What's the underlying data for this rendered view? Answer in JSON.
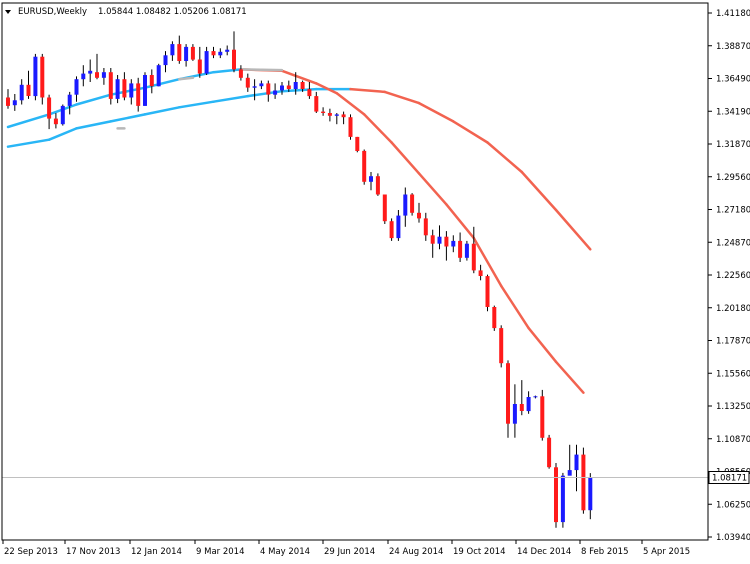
{
  "chart_data": {
    "type": "candlestick",
    "symbol": "EURUSD",
    "timeframe": "Weekly",
    "title": "EURUSD,Weekly",
    "ohlc_text": "1.05844 1.08482 1.05206 1.08171",
    "last_price": 1.08171,
    "last_price_label": "1.08171",
    "ylim": [
      1.0394,
      1.4121
    ],
    "yticks": [
      "1.41180",
      "1.38870",
      "1.36490",
      "1.34190",
      "1.31870",
      "1.29560",
      "1.27180",
      "1.24870",
      "1.22560",
      "1.20180",
      "1.17870",
      "1.15560",
      "1.13250",
      "1.10870",
      "1.08560",
      "1.06250",
      "1.03940"
    ],
    "xticks": [
      "22 Sep 2013",
      "17 Nov 2013",
      "12 Jan 2014",
      "9 Mar 2014",
      "4 May 2014",
      "29 Jun 2014",
      "24 Aug 2014",
      "19 Oct 2014",
      "14 Dec 2014",
      "8 Feb 2015",
      "5 Apr 2015"
    ],
    "grid": false,
    "colors": {
      "bull": "#1a1aff",
      "bear": "#ff1a1a",
      "wick": "#000000",
      "ma_fast_up": "#29b6f6",
      "ma_fast_down": "#f26350",
      "ma_flat": "#b8b8b8",
      "axis": "#000000",
      "price_line": "#c0c0c0"
    },
    "candles": [
      {
        "o": 1.352,
        "h": 1.358,
        "l": 1.344,
        "c": 1.346
      },
      {
        "o": 1.3465,
        "h": 1.3545,
        "l": 1.3425,
        "c": 1.35
      },
      {
        "o": 1.35,
        "h": 1.365,
        "l": 1.347,
        "c": 1.361
      },
      {
        "o": 1.361,
        "h": 1.371,
        "l": 1.351,
        "c": 1.353
      },
      {
        "o": 1.353,
        "h": 1.383,
        "l": 1.35,
        "c": 1.381
      },
      {
        "o": 1.381,
        "h": 1.383,
        "l": 1.347,
        "c": 1.352
      },
      {
        "o": 1.352,
        "h": 1.354,
        "l": 1.3295,
        "c": 1.337
      },
      {
        "o": 1.337,
        "h": 1.341,
        "l": 1.33,
        "c": 1.333
      },
      {
        "o": 1.333,
        "h": 1.347,
        "l": 1.332,
        "c": 1.346
      },
      {
        "o": 1.346,
        "h": 1.356,
        "l": 1.34,
        "c": 1.354
      },
      {
        "o": 1.354,
        "h": 1.367,
        "l": 1.349,
        "c": 1.365
      },
      {
        "o": 1.365,
        "h": 1.375,
        "l": 1.36,
        "c": 1.369
      },
      {
        "o": 1.369,
        "h": 1.379,
        "l": 1.363,
        "c": 1.371
      },
      {
        "o": 1.37,
        "h": 1.383,
        "l": 1.365,
        "c": 1.366
      },
      {
        "o": 1.366,
        "h": 1.373,
        "l": 1.361,
        "c": 1.37
      },
      {
        "o": 1.37,
        "h": 1.373,
        "l": 1.347,
        "c": 1.351
      },
      {
        "o": 1.351,
        "h": 1.368,
        "l": 1.348,
        "c": 1.365
      },
      {
        "o": 1.365,
        "h": 1.37,
        "l": 1.35,
        "c": 1.352
      },
      {
        "o": 1.352,
        "h": 1.365,
        "l": 1.347,
        "c": 1.362
      },
      {
        "o": 1.362,
        "h": 1.366,
        "l": 1.342,
        "c": 1.346
      },
      {
        "o": 1.346,
        "h": 1.37,
        "l": 1.346,
        "c": 1.368
      },
      {
        "o": 1.368,
        "h": 1.372,
        "l": 1.355,
        "c": 1.36
      },
      {
        "o": 1.36,
        "h": 1.376,
        "l": 1.36,
        "c": 1.375
      },
      {
        "o": 1.375,
        "h": 1.385,
        "l": 1.37,
        "c": 1.382
      },
      {
        "o": 1.382,
        "h": 1.392,
        "l": 1.378,
        "c": 1.39
      },
      {
        "o": 1.39,
        "h": 1.396,
        "l": 1.376,
        "c": 1.378
      },
      {
        "o": 1.378,
        "h": 1.39,
        "l": 1.374,
        "c": 1.388
      },
      {
        "o": 1.388,
        "h": 1.39,
        "l": 1.378,
        "c": 1.379
      },
      {
        "o": 1.379,
        "h": 1.388,
        "l": 1.366,
        "c": 1.369
      },
      {
        "o": 1.369,
        "h": 1.388,
        "l": 1.368,
        "c": 1.385
      },
      {
        "o": 1.385,
        "h": 1.388,
        "l": 1.38,
        "c": 1.382
      },
      {
        "o": 1.382,
        "h": 1.387,
        "l": 1.38,
        "c": 1.3845
      },
      {
        "o": 1.3845,
        "h": 1.389,
        "l": 1.382,
        "c": 1.386
      },
      {
        "o": 1.386,
        "h": 1.399,
        "l": 1.37,
        "c": 1.372
      },
      {
        "o": 1.372,
        "h": 1.375,
        "l": 1.364,
        "c": 1.366
      },
      {
        "o": 1.366,
        "h": 1.369,
        "l": 1.356,
        "c": 1.359
      },
      {
        "o": 1.359,
        "h": 1.365,
        "l": 1.35,
        "c": 1.36
      },
      {
        "o": 1.36,
        "h": 1.364,
        "l": 1.358,
        "c": 1.362
      },
      {
        "o": 1.362,
        "h": 1.364,
        "l": 1.349,
        "c": 1.354
      },
      {
        "o": 1.354,
        "h": 1.362,
        "l": 1.351,
        "c": 1.357
      },
      {
        "o": 1.357,
        "h": 1.363,
        "l": 1.354,
        "c": 1.3605
      },
      {
        "o": 1.3605,
        "h": 1.364,
        "l": 1.356,
        "c": 1.358
      },
      {
        "o": 1.358,
        "h": 1.37,
        "l": 1.354,
        "c": 1.363
      },
      {
        "o": 1.363,
        "h": 1.364,
        "l": 1.356,
        "c": 1.358
      },
      {
        "o": 1.358,
        "h": 1.363,
        "l": 1.351,
        "c": 1.353
      },
      {
        "o": 1.353,
        "h": 1.356,
        "l": 1.341,
        "c": 1.342
      },
      {
        "o": 1.342,
        "h": 1.345,
        "l": 1.339,
        "c": 1.341
      },
      {
        "o": 1.341,
        "h": 1.344,
        "l": 1.335,
        "c": 1.339
      },
      {
        "o": 1.339,
        "h": 1.341,
        "l": 1.333,
        "c": 1.34
      },
      {
        "o": 1.34,
        "h": 1.342,
        "l": 1.333,
        "c": 1.338
      },
      {
        "o": 1.338,
        "h": 1.34,
        "l": 1.322,
        "c": 1.324
      },
      {
        "o": 1.324,
        "h": 1.324,
        "l": 1.313,
        "c": 1.314
      },
      {
        "o": 1.314,
        "h": 1.315,
        "l": 1.29,
        "c": 1.292
      },
      {
        "o": 1.292,
        "h": 1.299,
        "l": 1.286,
        "c": 1.296
      },
      {
        "o": 1.296,
        "h": 1.298,
        "l": 1.282,
        "c": 1.283
      },
      {
        "o": 1.283,
        "h": 1.283,
        "l": 1.262,
        "c": 1.264
      },
      {
        "o": 1.264,
        "h": 1.266,
        "l": 1.25,
        "c": 1.252
      },
      {
        "o": 1.252,
        "h": 1.272,
        "l": 1.25,
        "c": 1.268
      },
      {
        "o": 1.268,
        "h": 1.288,
        "l": 1.26,
        "c": 1.283
      },
      {
        "o": 1.283,
        "h": 1.284,
        "l": 1.268,
        "c": 1.27
      },
      {
        "o": 1.27,
        "h": 1.277,
        "l": 1.263,
        "c": 1.266
      },
      {
        "o": 1.266,
        "h": 1.27,
        "l": 1.25,
        "c": 1.254
      },
      {
        "o": 1.254,
        "h": 1.258,
        "l": 1.238,
        "c": 1.248
      },
      {
        "o": 1.248,
        "h": 1.261,
        "l": 1.244,
        "c": 1.253
      },
      {
        "o": 1.253,
        "h": 1.257,
        "l": 1.236,
        "c": 1.246
      },
      {
        "o": 1.246,
        "h": 1.254,
        "l": 1.242,
        "c": 1.25
      },
      {
        "o": 1.25,
        "h": 1.256,
        "l": 1.235,
        "c": 1.238
      },
      {
        "o": 1.238,
        "h": 1.25,
        "l": 1.236,
        "c": 1.248
      },
      {
        "o": 1.248,
        "h": 1.26,
        "l": 1.227,
        "c": 1.229
      },
      {
        "o": 1.229,
        "h": 1.233,
        "l": 1.222,
        "c": 1.225
      },
      {
        "o": 1.225,
        "h": 1.226,
        "l": 1.2,
        "c": 1.203
      },
      {
        "o": 1.203,
        "h": 1.204,
        "l": 1.186,
        "c": 1.188
      },
      {
        "o": 1.188,
        "h": 1.19,
        "l": 1.16,
        "c": 1.163
      },
      {
        "o": 1.163,
        "h": 1.165,
        "l": 1.11,
        "c": 1.12
      },
      {
        "o": 1.12,
        "h": 1.148,
        "l": 1.11,
        "c": 1.134
      },
      {
        "o": 1.134,
        "h": 1.151,
        "l": 1.126,
        "c": 1.129
      },
      {
        "o": 1.129,
        "h": 1.143,
        "l": 1.127,
        "c": 1.139
      },
      {
        "o": 1.139,
        "h": 1.14,
        "l": 1.138,
        "c": 1.1395
      },
      {
        "o": 1.1395,
        "h": 1.144,
        "l": 1.108,
        "c": 1.11
      },
      {
        "o": 1.11,
        "h": 1.112,
        "l": 1.088,
        "c": 1.089
      },
      {
        "o": 1.089,
        "h": 1.092,
        "l": 1.046,
        "c": 1.05
      },
      {
        "o": 1.05,
        "h": 1.085,
        "l": 1.046,
        "c": 1.083
      },
      {
        "o": 1.083,
        "h": 1.105,
        "l": 1.085,
        "c": 1.087
      },
      {
        "o": 1.087,
        "h": 1.105,
        "l": 1.072,
        "c": 1.098
      },
      {
        "o": 1.098,
        "h": 1.103,
        "l": 1.056,
        "c": 1.0584
      },
      {
        "o": 1.05844,
        "h": 1.08482,
        "l": 1.05206,
        "c": 1.08171
      }
    ],
    "ma_fast": [
      [
        0,
        1.317
      ],
      [
        6,
        1.322
      ],
      [
        10,
        1.33
      ],
      [
        15,
        1.335
      ],
      [
        20,
        1.34
      ],
      [
        25,
        1.345
      ],
      [
        30,
        1.349
      ],
      [
        35,
        1.353
      ],
      [
        40,
        1.3565
      ],
      [
        45,
        1.358
      ],
      [
        50,
        1.358
      ],
      [
        55,
        1.356
      ],
      [
        60,
        1.348
      ],
      [
        65,
        1.335
      ],
      [
        70,
        1.32
      ],
      [
        75,
        1.299
      ],
      [
        80,
        1.272
      ],
      [
        85,
        1.244
      ]
    ],
    "ma_mid": [
      [
        0,
        1.331
      ],
      [
        6,
        1.34
      ],
      [
        10,
        1.347
      ],
      [
        15,
        1.354
      ],
      [
        20,
        1.359
      ],
      [
        25,
        1.365
      ],
      [
        30,
        1.37
      ],
      [
        34,
        1.372
      ],
      [
        40,
        1.371
      ],
      [
        45,
        1.362
      ],
      [
        48,
        1.355
      ],
      [
        52,
        1.34
      ],
      [
        56,
        1.32
      ],
      [
        60,
        1.298
      ],
      [
        64,
        1.276
      ],
      [
        68,
        1.252
      ],
      [
        72,
        1.218
      ],
      [
        76,
        1.188
      ],
      [
        80,
        1.164
      ],
      [
        84,
        1.142
      ]
    ],
    "ma_flat_segments": [
      [
        [
          16,
          1.33
        ],
        [
          17,
          1.33
        ]
      ],
      [
        [
          25,
          1.365
        ],
        [
          27,
          1.366
        ]
      ],
      [
        [
          34,
          1.372
        ],
        [
          40,
          1.3715
        ]
      ]
    ]
  }
}
